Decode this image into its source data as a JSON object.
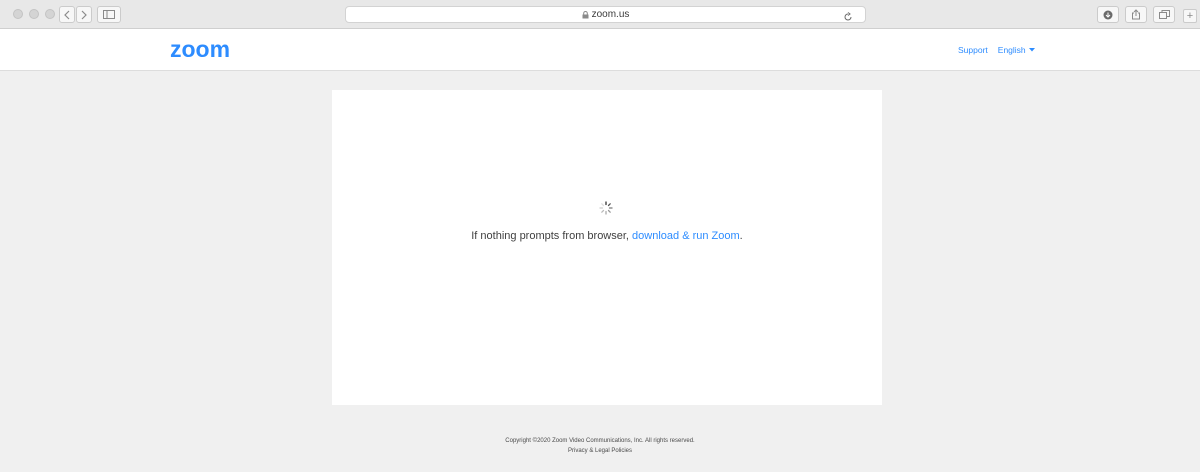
{
  "browser": {
    "url": "zoom.us",
    "icons": {
      "back": "chevron-left-icon",
      "forward": "chevron-right-icon",
      "sidebar": "sidebar-icon",
      "lock": "lock-icon",
      "reload": "reload-icon",
      "download": "download-icon",
      "share": "share-icon",
      "tabs": "tabs-icon"
    }
  },
  "header": {
    "logo_text": "zoom",
    "support_label": "Support",
    "language_label": "English"
  },
  "main": {
    "message_prefix": "If nothing prompts from browser, ",
    "message_link": "download & run Zoom",
    "message_suffix": "."
  },
  "footer": {
    "copyright": "Copyright ©2020 Zoom Video Communications, Inc. All rights reserved.",
    "policies_link": "Privacy & Legal Policies"
  },
  "colors": {
    "brand": "#2d8cff",
    "background": "#f0f0f0",
    "card": "#ffffff"
  }
}
